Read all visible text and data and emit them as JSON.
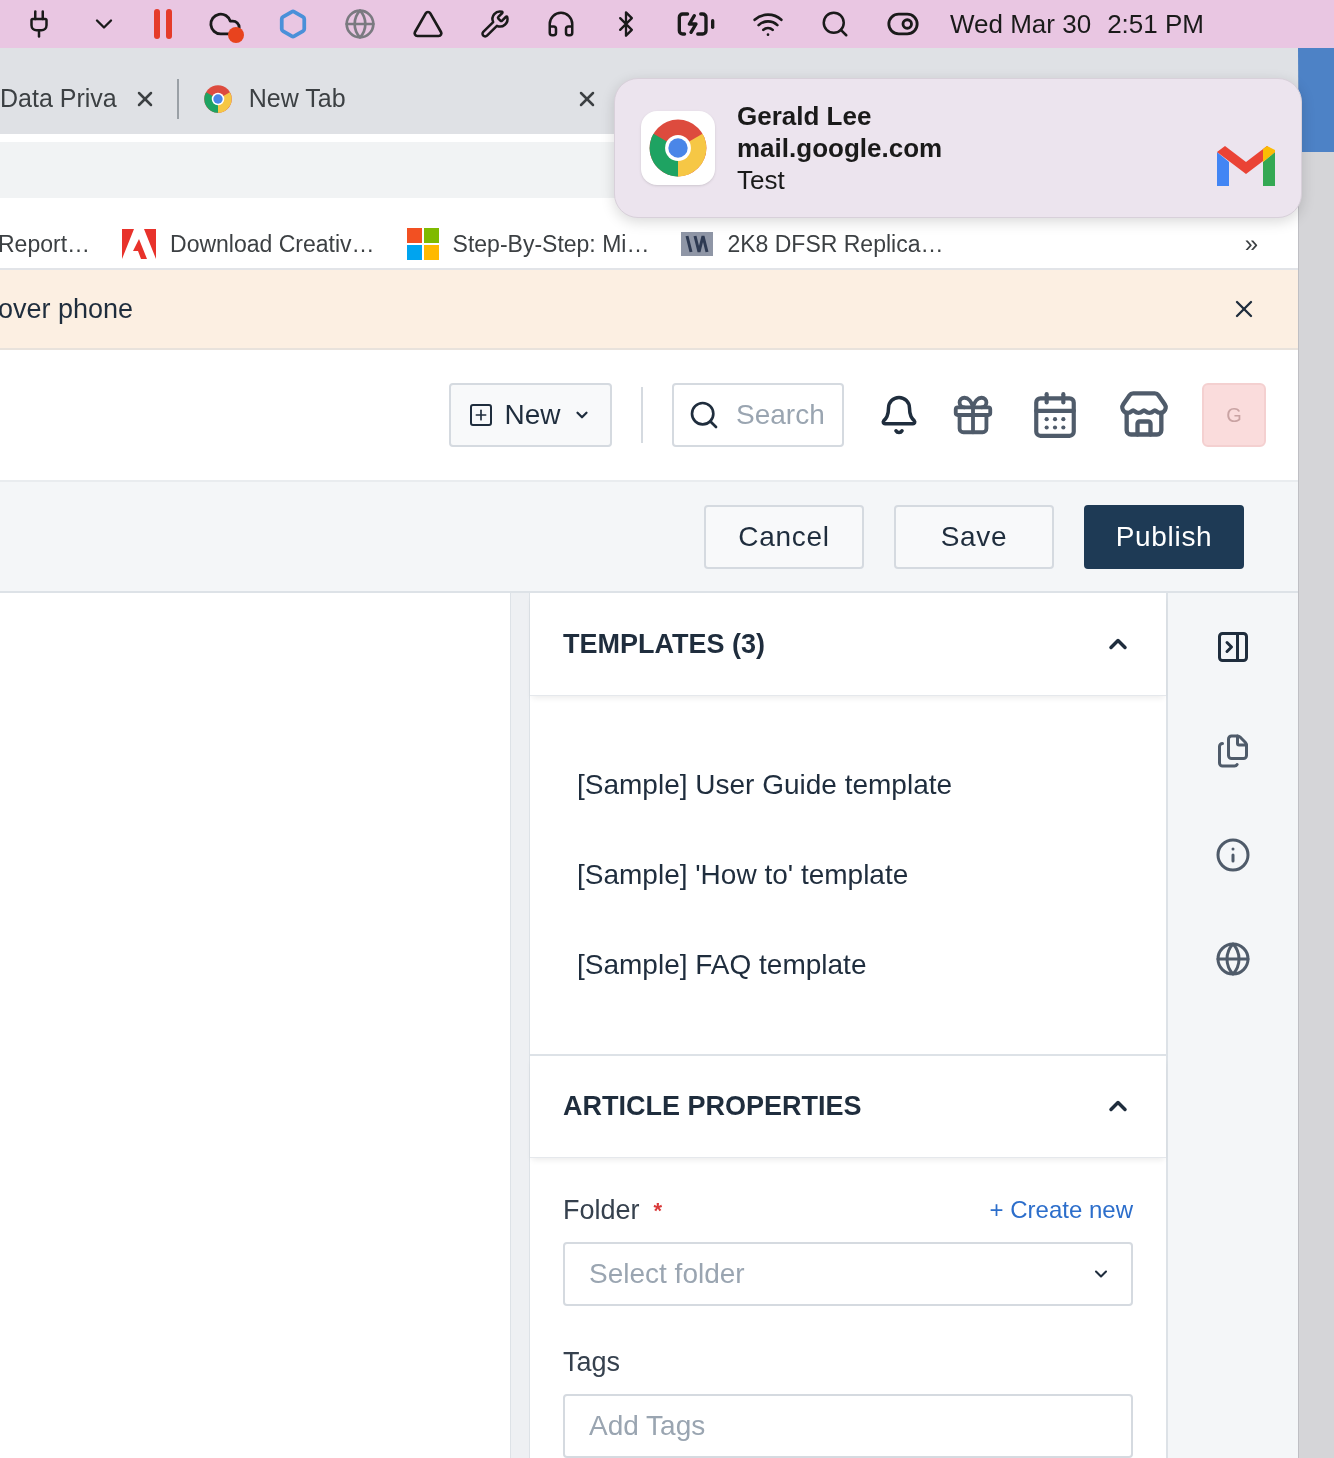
{
  "menu_bar": {
    "date": "Wed Mar 30",
    "time": "2:51 PM"
  },
  "tabs": [
    {
      "label": "Data Priva"
    },
    {
      "label": "New Tab"
    }
  ],
  "notification": {
    "title": "Gerald Lee",
    "source": "mail.google.com",
    "body": "Test"
  },
  "bookmarks": [
    {
      "label": "Report…",
      "kind": "none"
    },
    {
      "label": "Download Creativ…",
      "kind": "adobe"
    },
    {
      "label": "Step-By-Step: Mi…",
      "kind": "windows"
    },
    {
      "label": "2K8 DFSR Replica…",
      "kind": "doc"
    }
  ],
  "bookmarks_overflow": "»",
  "banner": {
    "text": "over phone"
  },
  "header": {
    "new_button": "New",
    "search": {
      "placeholder": "Search"
    },
    "avatar": "G"
  },
  "actions": [
    {
      "label": "Cancel",
      "kind": "secondary"
    },
    {
      "label": "Save",
      "kind": "secondary"
    },
    {
      "label": "Publish",
      "kind": "primary"
    }
  ],
  "templates": {
    "title": "TEMPLATES (3)",
    "expanded": true,
    "items": [
      "[Sample] User Guide template",
      "[Sample] 'How to' template",
      "[Sample] FAQ template"
    ]
  },
  "article_properties": {
    "title": "ARTICLE PROPERTIES",
    "expanded": true,
    "folder": {
      "label": "Folder",
      "required": true,
      "required_mark": "*",
      "create_link": "+ Create new",
      "placeholder": "Select folder"
    },
    "tags": {
      "label": "Tags",
      "placeholder": "Add Tags"
    }
  }
}
